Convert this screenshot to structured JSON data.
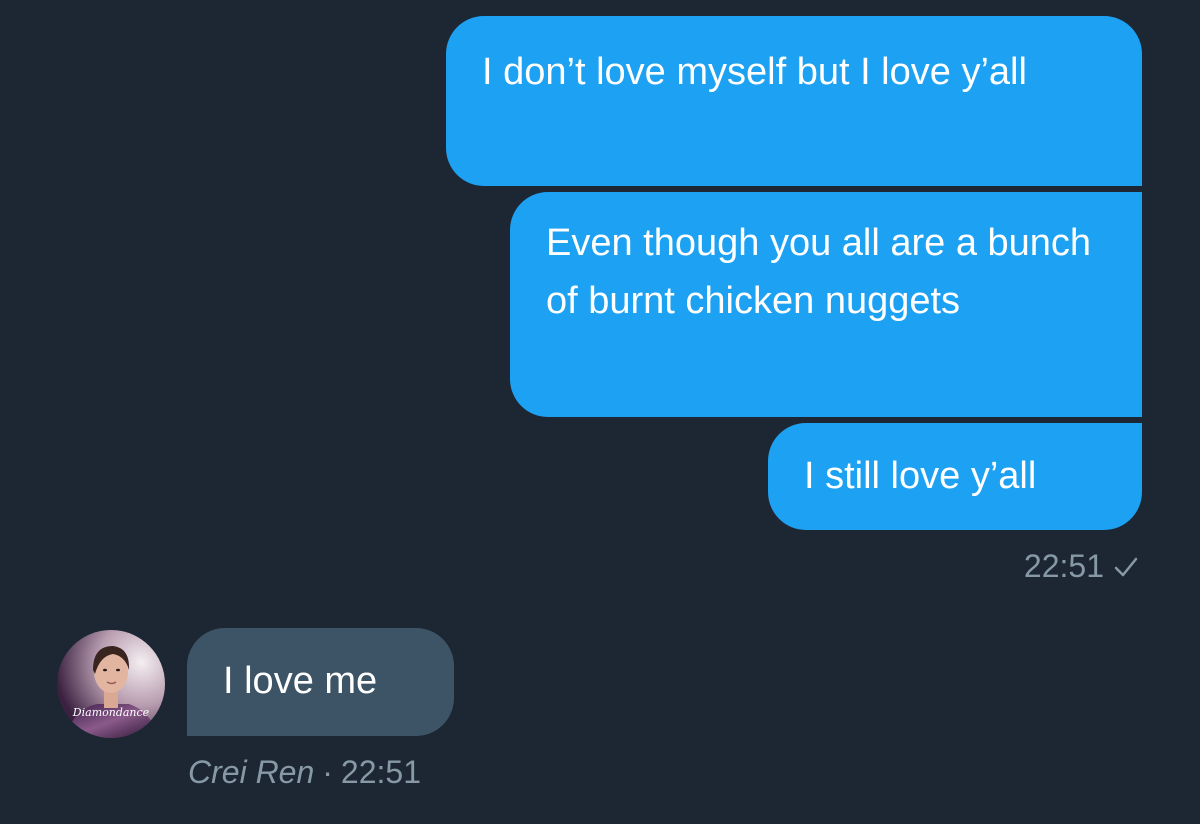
{
  "conversation": {
    "sent_messages": [
      {
        "text": "I don’t love myself but I love y’all"
      },
      {
        "text": "Even though you all are a bunch of burnt chicken nuggets"
      },
      {
        "text": "I still love y’all"
      }
    ],
    "sent_time": "22:51",
    "sent_status_icon": "check-icon",
    "received_message": {
      "text": "I love me",
      "sender_name": "Crei Ren",
      "separator": "·",
      "time": "22:51"
    },
    "avatar_watermark": "Diamondance"
  },
  "colors": {
    "background": "#1c2733",
    "sent_bubble": "#1da1f2",
    "received_bubble": "#3d5466",
    "meta_text": "#8899a6"
  }
}
